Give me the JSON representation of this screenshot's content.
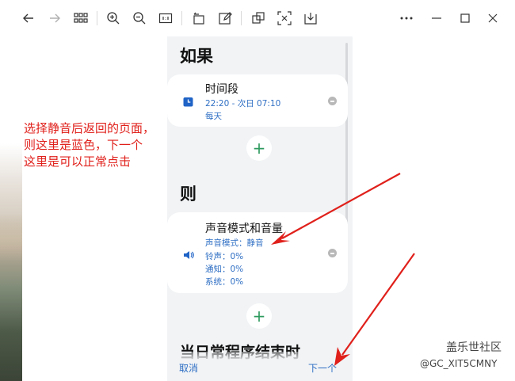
{
  "toolbar": {
    "icons": [
      "back-arrow-icon",
      "forward-arrow-icon",
      "grid-icon",
      "zoom-in-icon",
      "zoom-out-icon",
      "actual-size-icon",
      "rotate-icon",
      "edit-icon",
      "copy-icon",
      "fit-screen-icon",
      "save-icon",
      "more-icon",
      "minimize-icon",
      "maximize-icon",
      "close-icon"
    ]
  },
  "phone": {
    "if_title": "如果",
    "time_card": {
      "name": "时间段",
      "time_range": "22:20 - 次日 07:10",
      "repeat": "每天"
    },
    "then_title": "则",
    "sound_card": {
      "name": "声音模式和音量",
      "mode": "声音模式：静音",
      "ringtone": "铃声：0%",
      "notification": "通知：0%",
      "system": "系统：0%"
    },
    "add_symbol": "+",
    "cut_title": "当日常程序结束时",
    "cancel_label": "取消",
    "next_label": "下一个"
  },
  "annotation": {
    "lines": [
      "选择静音后返回的页面，",
      "则这里是蓝色，下一个",
      "这里是可以正常点击"
    ],
    "color": "#e0201b"
  },
  "watermark": {
    "site": "盖乐世社区",
    "user": "@GC_XIT5CMNY"
  },
  "colors": {
    "accent_blue": "#2f6fc4",
    "add_green": "#2e9a5e",
    "phone_bg": "#f1f3f5"
  }
}
